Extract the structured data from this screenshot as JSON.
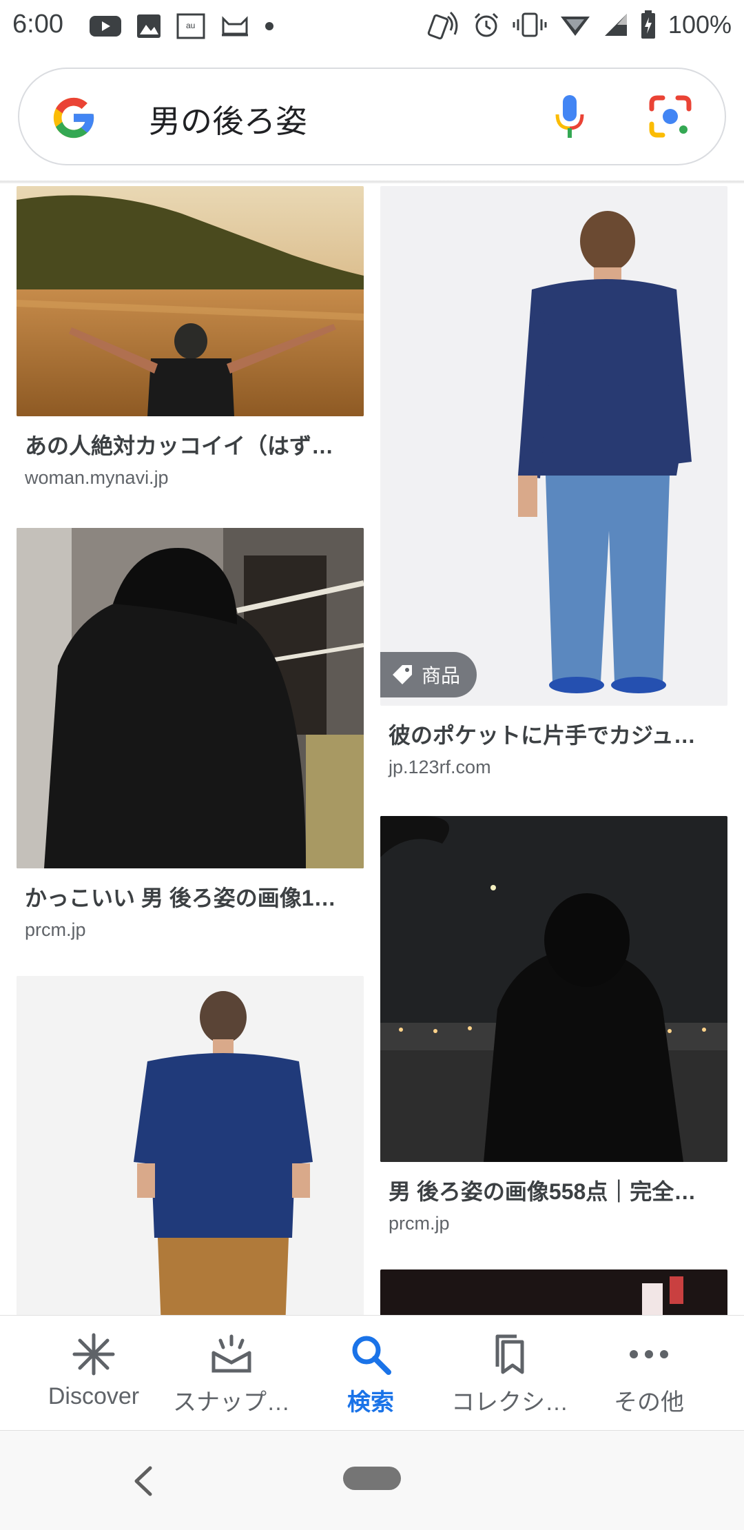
{
  "status_bar": {
    "time": "6:00",
    "battery": "100%",
    "left_icons": [
      "youtube-icon",
      "image-icon",
      "au-icon",
      "cat-icon",
      "dot-icon"
    ],
    "right_icons": [
      "nfc-icon",
      "alarm-icon",
      "vibrate-icon",
      "wifi-icon",
      "signal-icon",
      "battery-icon"
    ]
  },
  "search": {
    "query": "男の後ろ姿",
    "icons": [
      "google-logo",
      "mic-icon",
      "lens-icon"
    ]
  },
  "results": [
    {
      "title": "あの人絶対カッコイイ（はず…",
      "domain": "woman.mynavi.jp"
    },
    {
      "title": "彼のポケットに片手でカジュ…",
      "domain": "jp.123rf.com",
      "badge": "商品"
    },
    {
      "title": "かっこいい 男 後ろ姿の画像1…",
      "domain": "prcm.jp"
    },
    {
      "title": "男 後ろ姿の画像558点｜完全…",
      "domain": "prcm.jp"
    },
    {
      "title": "",
      "domain": ""
    },
    {
      "title": "",
      "domain": ""
    }
  ],
  "bottom_nav": {
    "items": [
      {
        "label": "Discover",
        "icon": "asterisk-icon",
        "active": false
      },
      {
        "label": "スナップ…",
        "icon": "snapshot-icon",
        "active": false
      },
      {
        "label": "検索",
        "icon": "search-icon",
        "active": true
      },
      {
        "label": "コレクシ…",
        "icon": "collections-icon",
        "active": false
      },
      {
        "label": "その他",
        "icon": "more-icon",
        "active": false
      }
    ]
  },
  "colors": {
    "accent": "#1a73e8",
    "google_blue": "#4285f4",
    "google_red": "#ea4335",
    "google_yellow": "#fbbc05",
    "google_green": "#34a853"
  }
}
